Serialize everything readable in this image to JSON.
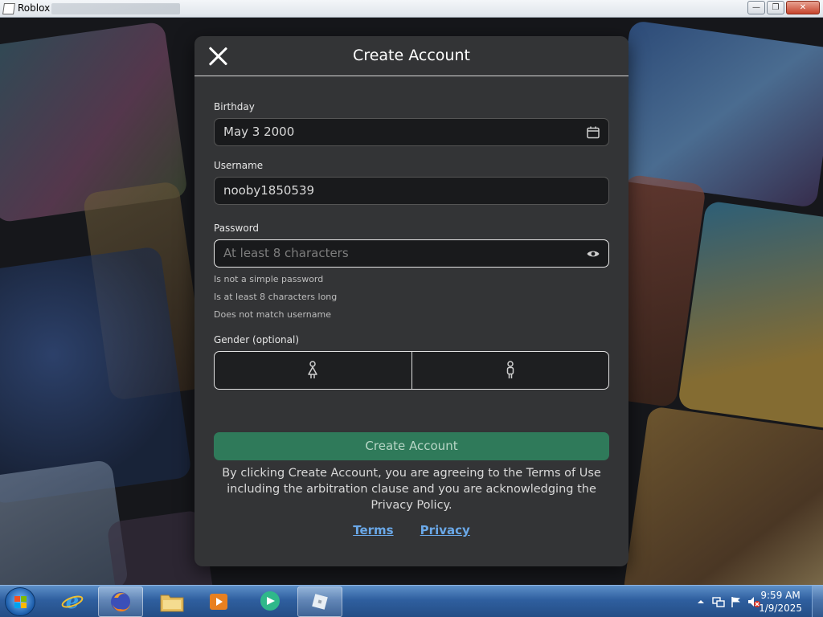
{
  "window": {
    "title": "Roblox",
    "controls": [
      "minimize",
      "restore",
      "close"
    ]
  },
  "dialog": {
    "title": "Create Account",
    "birthday": {
      "label": "Birthday",
      "value": "May 3 2000"
    },
    "username": {
      "label": "Username",
      "value": "nooby1850539"
    },
    "password": {
      "label": "Password",
      "placeholder": "At least 8 characters"
    },
    "password_hints": [
      "Is not a simple password",
      "Is at least 8 characters long",
      "Does not match username"
    ],
    "gender": {
      "label": "Gender (optional)",
      "options": [
        "female-icon",
        "male-icon"
      ]
    },
    "create_button": "Create Account",
    "legal_text": "By clicking Create Account, you are agreeing to the Terms of Use including the arbitration clause and you are acknowledging the Privacy Policy.",
    "links": {
      "terms": "Terms",
      "privacy": "Privacy"
    }
  },
  "taskbar": {
    "pinned": [
      "start-icon",
      "internet-explorer-icon",
      "firefox-icon",
      "file-explorer-icon",
      "media-player-icon",
      "chat-app-icon",
      "roblox-icon"
    ],
    "clock": {
      "time": "9:59 AM",
      "date": "1/9/2025"
    }
  },
  "colors": {
    "accent_green": "#2f7a5a",
    "link_blue": "#6aa8e8",
    "dialog_bg": "#333436"
  }
}
